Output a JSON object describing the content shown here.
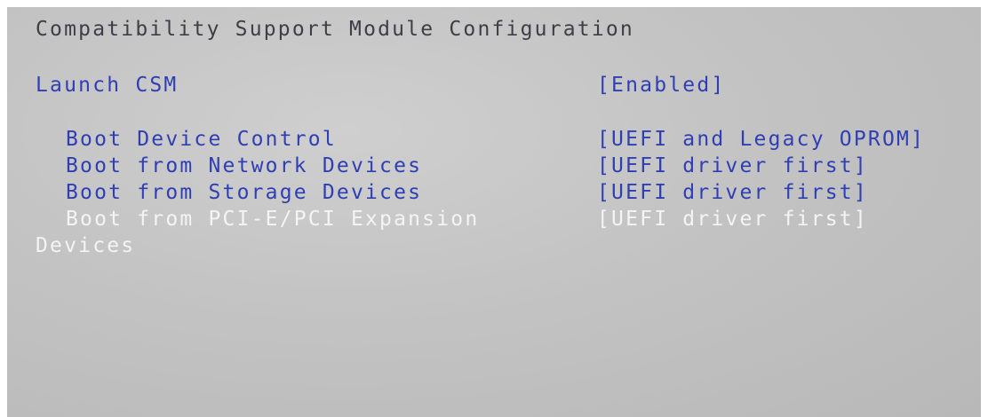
{
  "screen": {
    "title": "Compatibility Support Module Configuration",
    "launch_csm": {
      "label": "Launch CSM",
      "value": "[Enabled]"
    },
    "items": [
      {
        "label": "Boot Device Control",
        "value": "[UEFI and Legacy OPROM]"
      },
      {
        "label": "Boot from Network Devices",
        "value": "[UEFI driver first]"
      },
      {
        "label": "Boot from Storage Devices",
        "value": "[UEFI driver first]"
      },
      {
        "label_line1": "Boot from PCI-E/PCI Expansion",
        "label_line2": "Devices",
        "value": "[UEFI driver first]",
        "selected": true
      }
    ]
  },
  "colors": {
    "background": "#c3c3c3",
    "title_text": "#3e3e48",
    "option_text": "#2f3fb3",
    "selected_text": "#f4f4f4"
  }
}
